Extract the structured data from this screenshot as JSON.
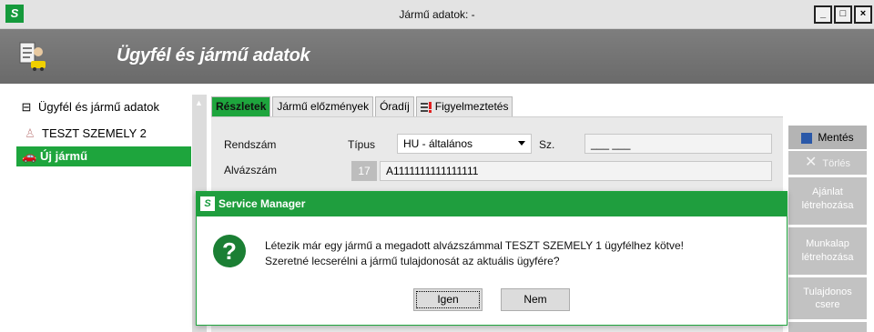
{
  "window": {
    "title": "Jármű adatok: -"
  },
  "banner": {
    "title": "Ügyfél és jármű adatok"
  },
  "sidebar": {
    "items": [
      {
        "label": "Ügyfél és jármű adatok",
        "icon": "collapse-icon"
      },
      {
        "label": "TESZT SZEMELY 2",
        "icon": "person-icon"
      },
      {
        "label": "Új jármű",
        "icon": "car-icon"
      }
    ]
  },
  "tabs": [
    {
      "label": "Részletek",
      "active": true
    },
    {
      "label": "Jármű előzmények"
    },
    {
      "label": "Óradíj"
    },
    {
      "label": "Figyelmeztetés",
      "icon": "warning-list-icon"
    }
  ],
  "form": {
    "rendszam_label": "Rendszám",
    "tipus_label": "Típus",
    "tipus_value": "HU - általános",
    "sz_label": "Sz.",
    "sz_value": "___ ___",
    "alvazszam_label": "Alvázszám",
    "alvazszam_count": "17",
    "alvazszam_value": "A1111111111111111"
  },
  "actions": {
    "save": "Mentés",
    "delete": "Törlés",
    "quote": [
      "Ajánlat",
      "létrehozása"
    ],
    "worksheet": [
      "Munkalap",
      "létrehozása"
    ],
    "owner": [
      "Tulajdonos",
      "csere"
    ]
  },
  "dialog": {
    "title": "Service Manager",
    "line1": "Létezik már egy jármű a megadott alvázszámmal TESZT SZEMELY 1 ügyfélhez kötve!",
    "line2": "Szeretné lecserélni a jármű tulajdonosát az aktuális ügyfére?",
    "yes": "Igen",
    "no": "Nem"
  },
  "colors": {
    "accent": "#1ea53d",
    "banner": "#737373"
  }
}
